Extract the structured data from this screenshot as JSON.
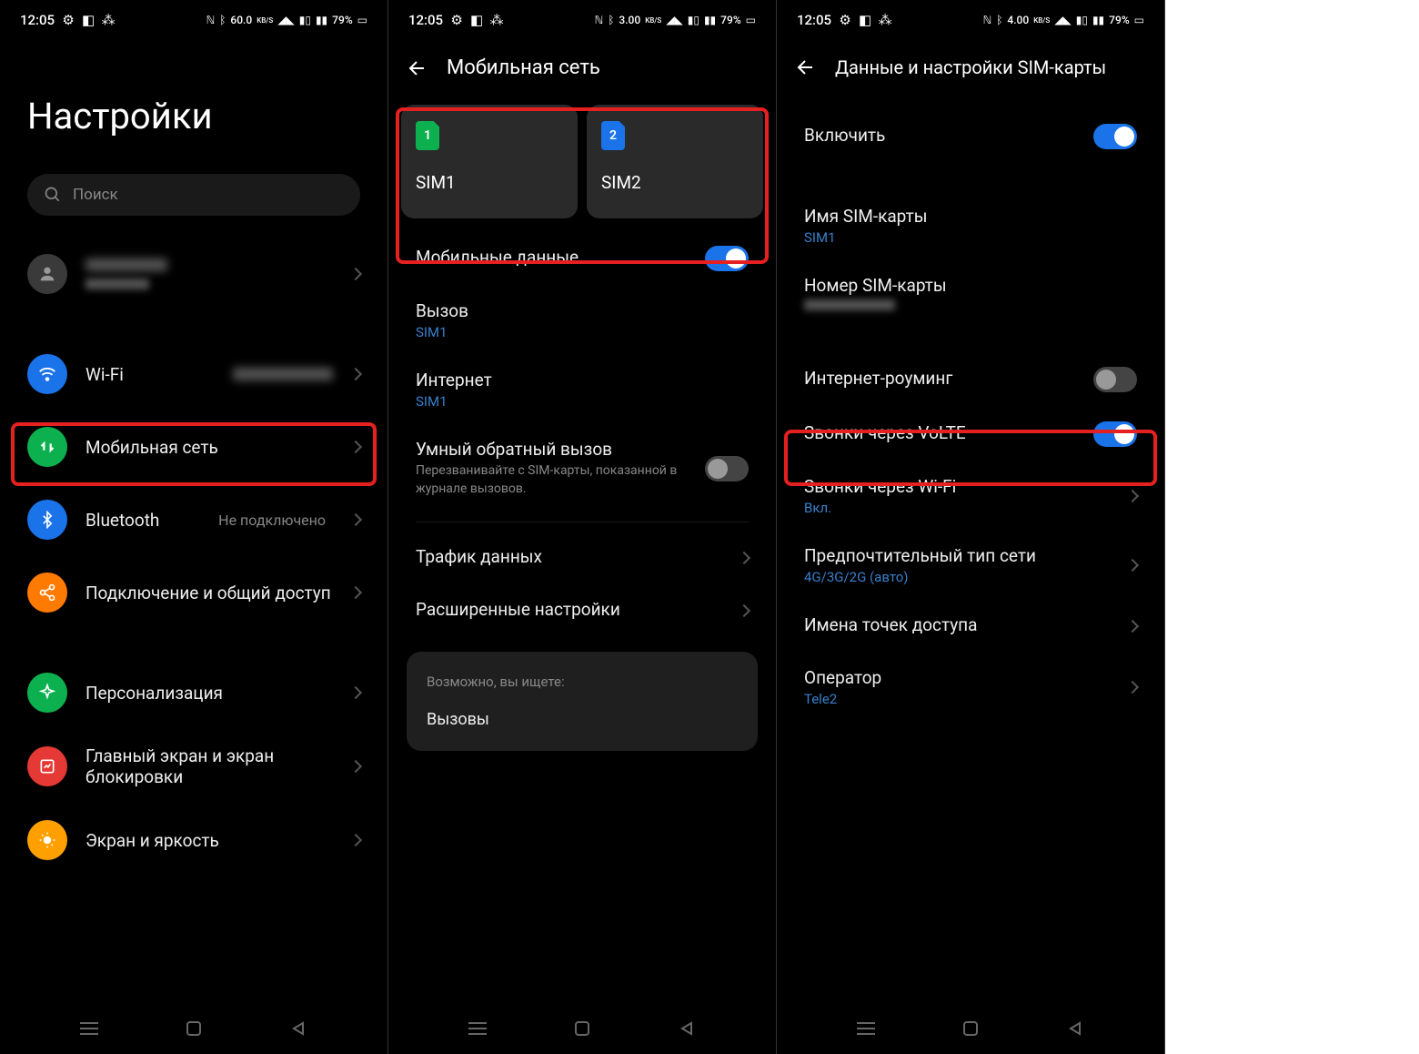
{
  "status": {
    "time": "12:05",
    "speed1": "60.0",
    "speed2": "3.00",
    "speed3": "4.00",
    "speed_unit": "KB/S",
    "battery": "79%"
  },
  "screen1": {
    "title": "Настройки",
    "search_placeholder": "Поиск",
    "account": {
      "name_blur": "████",
      "sub_blur": "████"
    },
    "items": {
      "wifi": {
        "label": "Wi-Fi",
        "value_blur": "████"
      },
      "mobile": {
        "label": "Мобильная сеть"
      },
      "bluetooth": {
        "label": "Bluetooth",
        "value": "Не подключено"
      },
      "connection": {
        "label": "Подключение и общий доступ"
      },
      "personalization": {
        "label": "Персонализация"
      },
      "home": {
        "label": "Главный экран и экран блокировки"
      },
      "display": {
        "label": "Экран и яркость"
      }
    }
  },
  "screen2": {
    "title": "Мобильная сеть",
    "sim1": {
      "badge": "1",
      "name": "SIM1"
    },
    "sim2": {
      "badge": "2",
      "name": "SIM2"
    },
    "items": {
      "mobile_data": {
        "label": "Мобильные данные"
      },
      "call": {
        "label": "Вызов",
        "sub": "SIM1"
      },
      "internet": {
        "label": "Интернет",
        "sub": "SIM1"
      },
      "smart_callback": {
        "label": "Умный обратный вызов",
        "desc": "Перезванивайте с SIM-карты, показанной в журнале вызовов."
      },
      "traffic": {
        "label": "Трафик данных"
      },
      "advanced": {
        "label": "Расширенные настройки"
      }
    },
    "suggest": {
      "title": "Возможно, вы ищете:",
      "item": "Вызовы"
    }
  },
  "screen3": {
    "title": "Данные и настройки SIM-карты",
    "items": {
      "enable": {
        "label": "Включить"
      },
      "sim_name": {
        "label": "Имя SIM-карты",
        "sub": "SIM1"
      },
      "sim_number": {
        "label": "Номер SIM-карты"
      },
      "roaming": {
        "label": "Интернет-роуминг"
      },
      "volte": {
        "label": "Звонки через VoLTE"
      },
      "wifi_calls": {
        "label": "Звонки через Wi-Fi",
        "sub": "Вкл."
      },
      "network_type": {
        "label": "Предпочтительный тип сети",
        "sub": "4G/3G/2G (авто)"
      },
      "apn": {
        "label": "Имена точек доступа"
      },
      "operator": {
        "label": "Оператор",
        "sub": "Tele2"
      }
    }
  }
}
